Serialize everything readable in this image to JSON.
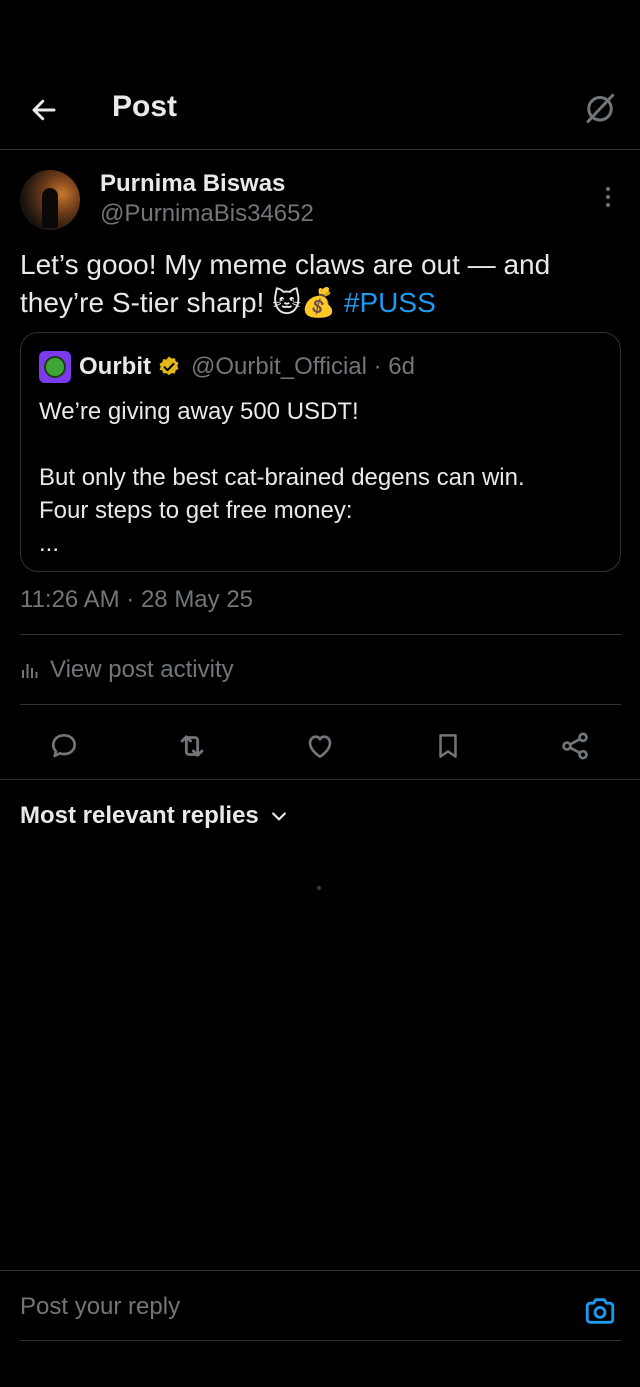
{
  "header": {
    "title": "Post"
  },
  "post": {
    "author_name": "Purnima Biswas",
    "author_handle": "@PurnimaBis34652",
    "text": "Let’s gooo! My meme claws are out — and they’re S-tier sharp! 🐱💰 ",
    "hashtag": "#PUSS",
    "timestamp": "11:26 AM · 28 May 25"
  },
  "quote": {
    "name": "Ourbit",
    "handle_time": "@Ourbit_Official · 6d",
    "body": "We’re giving away 500 USDT!\n\nBut only the best cat-brained degens can win.\nFour steps to get free money:\n..."
  },
  "activity": {
    "label": "View post activity"
  },
  "replies": {
    "sort_label": "Most relevant replies"
  },
  "reply_bar": {
    "placeholder": "Post your reply"
  },
  "colors": {
    "accent": "#1d9bf0",
    "muted": "#71767b",
    "border": "#2f3336",
    "verified": "#e2b719"
  }
}
